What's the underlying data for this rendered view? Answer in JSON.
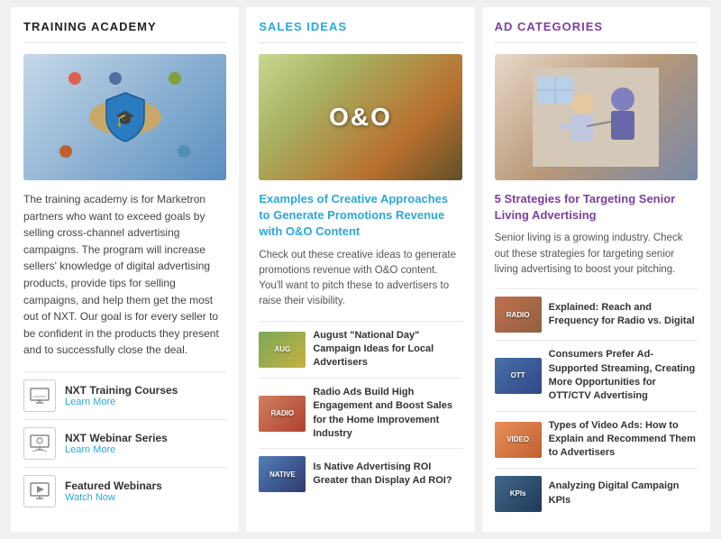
{
  "training": {
    "title": "TRAINING ACADEMY",
    "description": "The training academy is for Marketron partners who want to exceed goals by selling cross-channel advertising campaigns. The program will increase sellers' knowledge of digital advertising products, provide tips for selling campaigns, and help them get the most out of NXT. Our goal is for every seller to be confident in the products they present and to successfully close the deal.",
    "links": [
      {
        "id": "nxt-training",
        "icon": "monitor-icon",
        "title": "NXT Training Courses",
        "subtitle": "Learn More"
      },
      {
        "id": "nxt-webinar",
        "icon": "webinar-icon",
        "title": "NXT Webinar Series",
        "subtitle": "Learn More"
      },
      {
        "id": "featured-webinars",
        "icon": "play-icon",
        "title": "Featured Webinars",
        "subtitle": "Watch Now"
      }
    ]
  },
  "sales": {
    "title": "SALES IDEAS",
    "heroLabel": "O&O",
    "articleTitle": "Examples of Creative Approaches to Generate Promotions Revenue with O&O Content",
    "articleDesc": "Check out these creative ideas to generate promotions revenue with O&O content. You'll want to pitch these to advertisers to raise their visibility.",
    "miniArticles": [
      {
        "id": "aug-campaign",
        "thumbLabel": "AUG",
        "thumbClass": "thumb-aug",
        "title": "August \"National Day\" Campaign Ideas for Local Advertisers"
      },
      {
        "id": "radio-ads",
        "thumbLabel": "RADIO",
        "thumbClass": "thumb-radio",
        "title": "Radio Ads Build High Engagement and Boost Sales for the Home Improvement Industry"
      },
      {
        "id": "native-roi",
        "thumbLabel": "NATIVE",
        "thumbClass": "thumb-native",
        "title": "Is Native Advertising ROI Greater than Display Ad ROI?"
      }
    ]
  },
  "ad": {
    "title": "AD CATEGORIES",
    "articleTitle": "5 Strategies for Targeting Senior Living Advertising",
    "articleDesc": "Senior living is a growing industry. Check out these strategies for targeting senior living advertising to boost your pitching.",
    "miniArticles": [
      {
        "id": "reach-freq",
        "thumbLabel": "RADIO",
        "thumbClass": "thumb-explain",
        "title": "Explained: Reach and Frequency for Radio vs. Digital"
      },
      {
        "id": "consumers",
        "thumbLabel": "OTT",
        "thumbClass": "thumb-consumers",
        "title": "Consumers Prefer Ad-Supported Streaming, Creating More Opportunities for OTT/CTV Advertising"
      },
      {
        "id": "video-types",
        "thumbLabel": "VIDEO",
        "thumbClass": "thumb-types",
        "title": "Types of Video Ads: How to Explain and Recommend Them to Advertisers"
      },
      {
        "id": "digital-kpis",
        "thumbLabel": "KPIs",
        "thumbClass": "thumb-analyzing",
        "title": "Analyzing Digital Campaign KPIs"
      }
    ]
  }
}
